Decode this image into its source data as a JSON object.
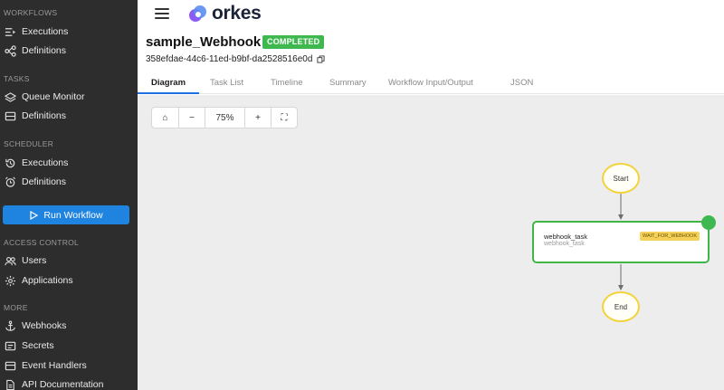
{
  "sidebar": {
    "sections": [
      {
        "title": "WORKFLOWS",
        "items": [
          {
            "label": "Executions",
            "icon": "executions-list-icon"
          },
          {
            "label": "Definitions",
            "icon": "workflow-graph-icon"
          }
        ]
      },
      {
        "title": "TASKS",
        "items": [
          {
            "label": "Queue Monitor",
            "icon": "layers-icon"
          },
          {
            "label": "Definitions",
            "icon": "task-box-icon"
          }
        ]
      },
      {
        "title": "SCHEDULER",
        "items": [
          {
            "label": "Executions",
            "icon": "history-icon"
          },
          {
            "label": "Definitions",
            "icon": "alarm-clock-icon"
          }
        ]
      },
      {
        "title": "ACCESS CONTROL",
        "items": [
          {
            "label": "Users",
            "icon": "users-icon"
          },
          {
            "label": "Applications",
            "icon": "gear-icon"
          }
        ]
      },
      {
        "title": "MORE",
        "items": [
          {
            "label": "Webhooks",
            "icon": "anchor-icon"
          },
          {
            "label": "Secrets",
            "icon": "secrets-box-icon"
          },
          {
            "label": "Event Handlers",
            "icon": "event-box-icon"
          },
          {
            "label": "API Documentation",
            "icon": "document-icon"
          }
        ]
      }
    ],
    "run_button_label": "Run Workflow"
  },
  "header": {
    "logo_text": "orkes"
  },
  "workflow": {
    "name": "sample_Webhook",
    "status": "COMPLETED",
    "id": "358efdae-44c6-11ed-b9bf-da2528516e0d"
  },
  "tabs": [
    "Diagram",
    "Task List",
    "Timeline",
    "Summary",
    "Workflow Input/Output",
    "JSON"
  ],
  "active_tab": "Diagram",
  "zoom": {
    "level": "75%",
    "home": "⌂",
    "minus": "−",
    "plus": "+",
    "fit": "⛶"
  },
  "graph": {
    "start_label": "Start",
    "end_label": "End",
    "task": {
      "name": "webhook_task",
      "reference": "webhook_task",
      "type": "WAIT_FOR_WEBHOOK"
    }
  },
  "colors": {
    "sidebar_bg": "#2d2d2d",
    "accent": "#1f83e0",
    "success": "#3fb94f",
    "node_border": "#f2d43a"
  }
}
